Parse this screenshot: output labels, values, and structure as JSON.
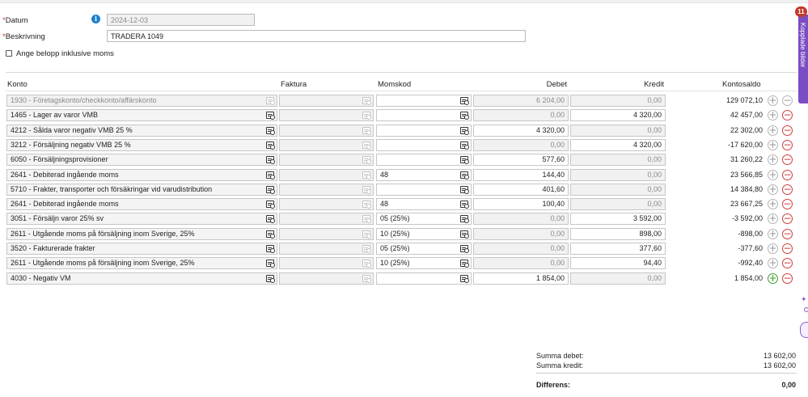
{
  "form": {
    "datum_label": "Datum",
    "datum_value": "2024-12-03",
    "beskrivning_label": "Beskrivning",
    "beskrivning_value": "TRADERA 1049",
    "inkl_moms_label": "Ange belopp inklusive moms",
    "inkl_moms_checked": false,
    "required_marker": "*",
    "info_icon_glyph": "i"
  },
  "table": {
    "headers": {
      "konto": "Konto",
      "faktura": "Faktura",
      "momskod": "Momskod",
      "debet": "Debet",
      "kredit": "Kredit",
      "kontosaldo": "Kontosaldo"
    },
    "rows": [
      {
        "konto": "1930 - Företagskonto/checkkonto/affärskonto",
        "momskod": "",
        "debet": "6 204,00",
        "kredit": "0,00",
        "saldo": "129 072,10",
        "disabled": true
      },
      {
        "konto": "1465 - Lager av varor VMB",
        "momskod": "",
        "debet": "0,00",
        "kredit": "4 320,00",
        "saldo": "42 457,00",
        "disabled": false
      },
      {
        "konto": "4212 - Sålda varor negativ VMB 25 %",
        "momskod": "",
        "debet": "4 320,00",
        "kredit": "0,00",
        "saldo": "22 302,00",
        "disabled": false
      },
      {
        "konto": "3212 - Försäljning negativ VMB 25 %",
        "momskod": "",
        "debet": "0,00",
        "kredit": "4 320,00",
        "saldo": "-17 620,00",
        "disabled": false
      },
      {
        "konto": "6050 - Försäljningsprovisioner",
        "momskod": "",
        "debet": "577,60",
        "kredit": "0,00",
        "saldo": "31 260,22",
        "disabled": false
      },
      {
        "konto": "2641 - Debiterad ingående moms",
        "momskod": "48",
        "debet": "144,40",
        "kredit": "0,00",
        "saldo": "23 566,85",
        "disabled": false
      },
      {
        "konto": "5710 - Frakter, transporter och försäkringar vid varudistribution",
        "momskod": "",
        "debet": "401,60",
        "kredit": "0,00",
        "saldo": "14 384,80",
        "disabled": false
      },
      {
        "konto": "2641 - Debiterad ingående moms",
        "momskod": "48",
        "debet": "100,40",
        "kredit": "0,00",
        "saldo": "23 667,25",
        "disabled": false
      },
      {
        "konto": "3051 - Försäljn varor 25% sv",
        "momskod": "05 (25%)",
        "debet": "0,00",
        "kredit": "3 592,00",
        "saldo": "-3 592,00",
        "disabled": false
      },
      {
        "konto": "2611 - Utgående moms på försäljning inom Sverige, 25%",
        "momskod": "10 (25%)",
        "debet": "0,00",
        "kredit": "898,00",
        "saldo": "-898,00",
        "disabled": false
      },
      {
        "konto": "3520 - Fakturerade frakter",
        "momskod": "05 (25%)",
        "debet": "0,00",
        "kredit": "377,60",
        "saldo": "-377,60",
        "disabled": false
      },
      {
        "konto": "2611 - Utgående moms på försäljning inom Sverige, 25%",
        "momskod": "10 (25%)",
        "debet": "0,00",
        "kredit": "94,40",
        "saldo": "-992,40",
        "disabled": false
      },
      {
        "konto": "4030 - Negativ VM",
        "momskod": "",
        "debet": "1 854,00",
        "kredit": "0,00",
        "saldo": "1 854,00",
        "disabled": false
      }
    ]
  },
  "summary": {
    "debet_label": "Summa debet:",
    "debet_value": "13 602,00",
    "kredit_label": "Summa kredit:",
    "kredit_value": "13 602,00",
    "diff_label": "Differens:",
    "diff_value": "0,00"
  },
  "side_panel": {
    "tab_label": "Kopplade bilder",
    "badge_count": "11"
  },
  "colors": {
    "accent_purple": "#7b4cc3",
    "badge_red": "#c0392b",
    "info_blue": "#1b7fd1",
    "minus_red": "#d23b3b",
    "plus_green": "#3a9c2f"
  },
  "icons": {
    "plus": "+",
    "minus": "−"
  }
}
